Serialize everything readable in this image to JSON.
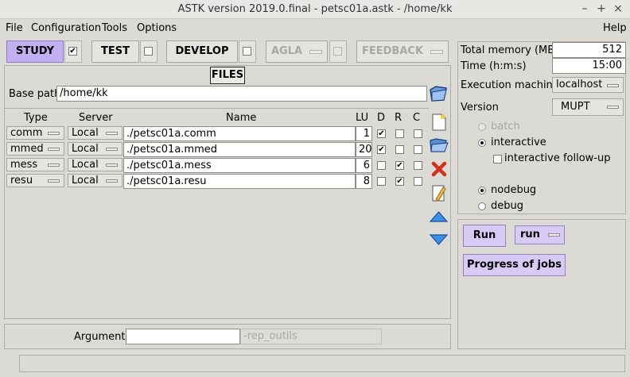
{
  "window": {
    "title": "ASTK version 2019.0.final - petsc01a.astk - /home/kk",
    "controls": [
      "–",
      "+",
      "×"
    ]
  },
  "menu": {
    "file": "File",
    "configuration": "Configuration",
    "tools": "Tools",
    "options": "Options",
    "help": "Help"
  },
  "modes": [
    {
      "label": "STUDY",
      "checked": "✔"
    },
    {
      "label": "TEST",
      "checked": ""
    },
    {
      "label": "DEVELOP",
      "checked": ""
    },
    {
      "label": "AGLA",
      "checked": ""
    },
    {
      "label": "FEEDBACK",
      "checked": ""
    }
  ],
  "files": {
    "title": "FILES",
    "base_path_label": "Base path",
    "base_path_value": "/home/kk",
    "columns": {
      "type": "Type",
      "server": "Server",
      "name": "Name",
      "lu": "LU",
      "d": "D",
      "r": "R",
      "c": "C"
    },
    "rows": [
      {
        "type": "comm",
        "server": "Local",
        "name": "./petsc01a.comm",
        "lu": "1",
        "d": "✔",
        "r": "",
        "c": ""
      },
      {
        "type": "mmed",
        "server": "Local",
        "name": "./petsc01a.mmed",
        "lu": "20",
        "d": "✔",
        "r": "",
        "c": ""
      },
      {
        "type": "mess",
        "server": "Local",
        "name": "./petsc01a.mess",
        "lu": "6",
        "d": "",
        "r": "✔",
        "c": ""
      },
      {
        "type": "resu",
        "server": "Local",
        "name": "./petsc01a.resu",
        "lu": "8",
        "d": "",
        "r": "✔",
        "c": ""
      }
    ]
  },
  "arguments": {
    "label": "Arguments",
    "value": "",
    "extra": "-rep_outils"
  },
  "settings": {
    "memory_label": "Total memory (MB)",
    "memory_value": "512",
    "time_label": "Time (h:m:s)",
    "time_value": "15:00",
    "machine_label": "Execution machine",
    "machine_value": "localhost",
    "version_label": "Version",
    "version_value": "MUPT",
    "batch": "batch",
    "interactive": "interactive",
    "followup": "interactive follow-up",
    "nodebug": "nodebug",
    "debug": "debug"
  },
  "run": {
    "run_label": "Run",
    "run_mode": "run",
    "progress_label": "Progress of jobs"
  },
  "colors": {
    "active_mode": "#c2b0f2",
    "run_button": "#d6cbf6",
    "background": "#dcdad5"
  },
  "icons": [
    "new-file-icon",
    "open-folder-icon",
    "delete-icon",
    "edit-icon",
    "up-arrow-icon",
    "down-arrow-icon",
    "folder-icon"
  ]
}
